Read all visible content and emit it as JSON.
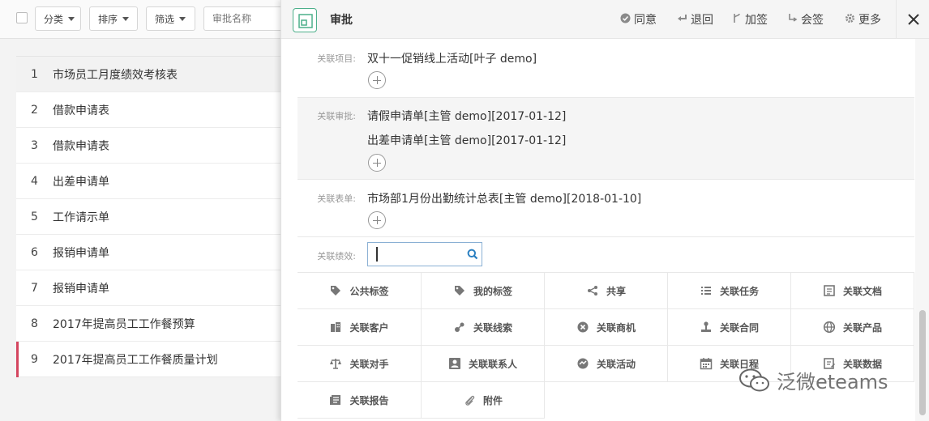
{
  "toolbar": {
    "category_label": "分类",
    "sort_label": "排序",
    "filter_label": "筛选",
    "search_placeholder": "审批名称"
  },
  "list": [
    {
      "num": "1",
      "title": "市场员工月度绩效考核表"
    },
    {
      "num": "2",
      "title": "借款申请表"
    },
    {
      "num": "3",
      "title": "借款申请表"
    },
    {
      "num": "4",
      "title": "出差申请单"
    },
    {
      "num": "5",
      "title": "工作请示单"
    },
    {
      "num": "6",
      "title": "报销申请单"
    },
    {
      "num": "7",
      "title": "报销申请单"
    },
    {
      "num": "8",
      "title": "2017年提高员工工作餐预算"
    },
    {
      "num": "9",
      "title": "2017年提高员工工作餐质量计划"
    }
  ],
  "panel": {
    "title": "审批",
    "actions": {
      "agree": "同意",
      "return": "退回",
      "add_sign": "加签",
      "countersign": "会签",
      "more": "更多"
    }
  },
  "sections": {
    "project_label": "关联项目:",
    "project_value": "双十一促销线上活动[叶子 demo]",
    "approval_label": "关联审批:",
    "approval_values": [
      "请假申请单[主管 demo][2017-01-12]",
      "出差申请单[主管 demo][2017-01-12]"
    ],
    "form_label": "关联表单:",
    "form_value": "市场部1月份出勤统计总表[主管 demo][2018-01-10]",
    "performance_label": "关联绩效:"
  },
  "grid": [
    {
      "label": "公共标签",
      "icon": "tag-icon"
    },
    {
      "label": "我的标签",
      "icon": "tag-icon"
    },
    {
      "label": "共享",
      "icon": "share-icon"
    },
    {
      "label": "关联任务",
      "icon": "list-icon"
    },
    {
      "label": "关联文档",
      "icon": "document-icon"
    },
    {
      "label": "关联客户",
      "icon": "building-icon"
    },
    {
      "label": "关联线索",
      "icon": "clue-icon"
    },
    {
      "label": "关联商机",
      "icon": "opportunity-icon"
    },
    {
      "label": "关联合同",
      "icon": "stamp-icon"
    },
    {
      "label": "关联产品",
      "icon": "globe-icon"
    },
    {
      "label": "关联对手",
      "icon": "scale-icon"
    },
    {
      "label": "关联联系人",
      "icon": "contact-icon"
    },
    {
      "label": "关联活动",
      "icon": "activity-icon"
    },
    {
      "label": "关联日程",
      "icon": "calendar-icon"
    },
    {
      "label": "关联数据",
      "icon": "data-icon"
    },
    {
      "label": "关联报告",
      "icon": "report-icon"
    },
    {
      "label": "附件",
      "icon": "paperclip-icon"
    }
  ],
  "watermark": "泛微eteams"
}
